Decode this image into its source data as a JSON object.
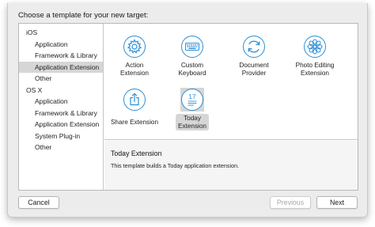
{
  "dialog": {
    "heading": "Choose a template for your new target:"
  },
  "sidebar": {
    "sections": [
      {
        "label": "iOS",
        "items": [
          "Application",
          "Framework & Library",
          "Application Extension",
          "Other"
        ]
      },
      {
        "label": "OS X",
        "items": [
          "Application",
          "Framework & Library",
          "Application Extension",
          "System Plug-in",
          "Other"
        ]
      }
    ],
    "selected": "iOS / Application Extension"
  },
  "templates": [
    {
      "label": "Action\nExtension",
      "icon": "gear-icon"
    },
    {
      "label": "Custom\nKeyboard",
      "icon": "keyboard-icon"
    },
    {
      "label": "Document\nProvider",
      "icon": "refresh-arrows-icon"
    },
    {
      "label": "Photo Editing\nExtension",
      "icon": "flower-icon"
    },
    {
      "label": "Share Extension",
      "icon": "share-icon"
    },
    {
      "label": "Today\nExtension",
      "icon": "calendar-list-icon",
      "icon_text": "17"
    }
  ],
  "selected_template": "Today Extension",
  "description": {
    "title": "Today Extension",
    "text": "This template builds a Today application extension."
  },
  "buttons": {
    "cancel": "Cancel",
    "previous": "Previous",
    "next": "Next"
  },
  "colors": {
    "icon_blue": "#2b8fd6",
    "selection": "#d6d6d6"
  }
}
